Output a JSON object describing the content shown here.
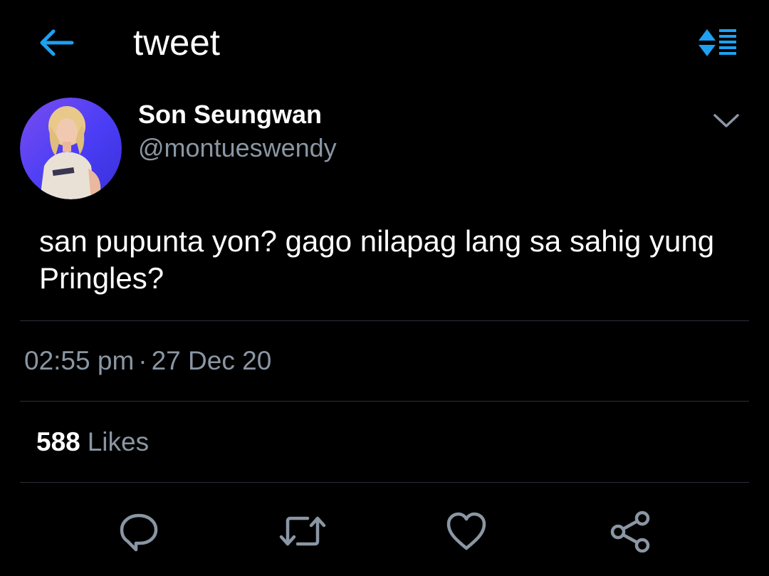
{
  "header": {
    "title": "tweet",
    "back_icon": "arrow-left-icon",
    "sort_icon": "sort-list-icon",
    "accent_color": "#1da1f2"
  },
  "tweet": {
    "author": {
      "display_name": "Son Seungwan",
      "handle": "@montueswendy",
      "avatar": "avatar-photo"
    },
    "text": "san pupunta yon? gago nilapag lang sa sahig yung Pringles?",
    "time": "02:55 pm",
    "separator": "·",
    "date": "27 Dec 20",
    "likes": {
      "count": "588",
      "label": "Likes"
    },
    "actions": [
      {
        "name": "reply",
        "icon": "comment-icon"
      },
      {
        "name": "retweet",
        "icon": "retweet-icon"
      },
      {
        "name": "like",
        "icon": "heart-icon"
      },
      {
        "name": "share",
        "icon": "share-icon"
      }
    ]
  },
  "colors": {
    "background": "#000000",
    "text": "#ffffff",
    "secondary_text": "#8a96a3",
    "icon": "#8a96a3",
    "divider": "#2a2f35"
  }
}
